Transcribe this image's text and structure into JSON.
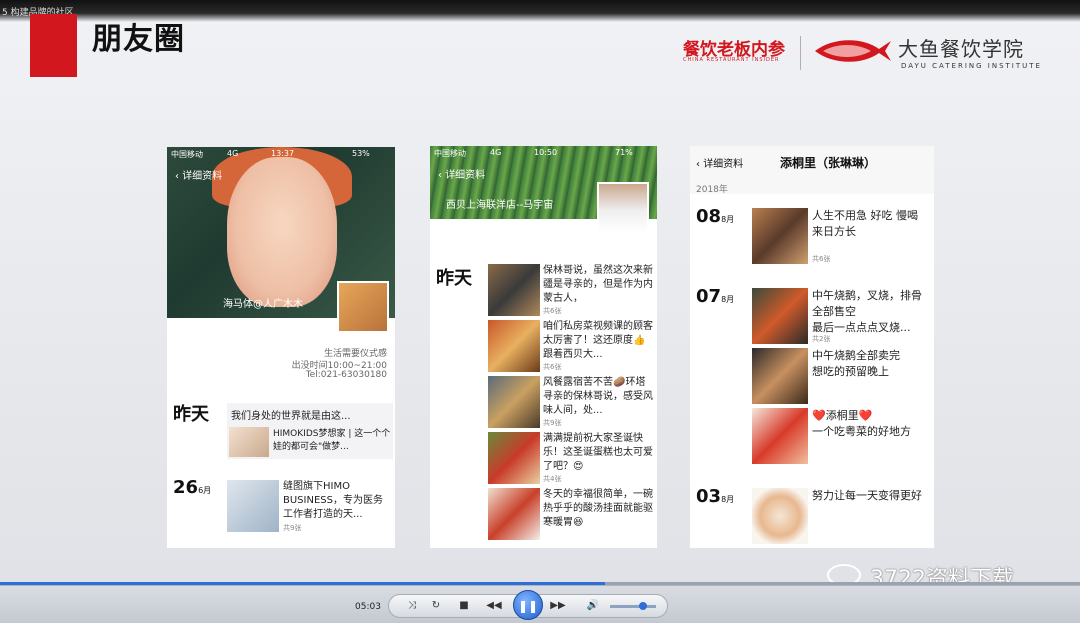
{
  "window": {
    "title_fragment": "5  构建品牌的社区"
  },
  "slide": {
    "title": "朋友圈",
    "brand1": "餐饮老板内参",
    "brand1_sub": "CHINA RESTAURANT INSIDER",
    "brand2": "大鱼餐饮学院",
    "brand2_sub": "DAYU CATERING INSTITUTE",
    "accent": "#d3171e"
  },
  "phone1": {
    "status": {
      "carrier": "中国移动",
      "network": "4G",
      "time": "13:37",
      "battery": "53%"
    },
    "back_label": "详细资料",
    "cover_name": "海马体@人广木木",
    "sign_lines": [
      "生活需要仪式感",
      "出没时间10:00~21:00",
      "Tel:021-63030180"
    ],
    "day1": "昨天",
    "post1_text": "我们身处的世界就是由这...",
    "post2_text": "HIMOKIDS梦想家 | 这一个个娃的都可会\"做梦...",
    "day2": {
      "day": "26",
      "month": "6月"
    },
    "post3_text": "缝图旗下HIMO BUSINESS，专为医务工作者打造的天...",
    "post3_count": "共9张"
  },
  "phone2": {
    "status": {
      "carrier": "中国移动",
      "network": "4G",
      "time": "10:50",
      "battery": "71%"
    },
    "back_label": "详细资料",
    "cover_name": "西贝上海联洋店--马宇宙",
    "day": "昨天",
    "items": [
      {
        "text": "保林哥说，虽然这次来新疆是寻亲的，但是作为内蒙古人，",
        "count": "共6张"
      },
      {
        "text": "咱们私房菜视频课的顾客太厉害了！这还原度👍跟着西贝大...",
        "count": "共6张"
      },
      {
        "text": "风餐露宿苦不苦🥔环塔寻亲的保林哥说，感受风味人间，处...",
        "count": "共9张"
      },
      {
        "text": "满满提前祝大家圣诞快乐！这圣诞蛋糕也太可爱了吧？😍",
        "count": "共4张"
      },
      {
        "text": "冬天的幸福很简单，一碗热乎乎的酸汤挂面就能驱寒暖胃😆",
        "count": ""
      }
    ]
  },
  "phone3": {
    "back_label": "详细资料",
    "title": "添桐里（张琳琳）",
    "year": "2018年",
    "entries": [
      {
        "day": "08",
        "month": "8月",
        "text": "人生不用急 好吃 慢喝 来日方长",
        "count": "共6张"
      },
      {
        "day": "07",
        "month": "8月",
        "text": "中午烧鹅，叉烧，排骨全部售空\n最后一点点点叉烧...",
        "count": "共2张"
      },
      {
        "day": "",
        "month": "",
        "text": "中午烧鹅全部卖完\n想吃的预留晚上",
        "count": ""
      },
      {
        "day": "",
        "month": "",
        "text": "❤️添桐里❤️\n一个吃粤菜的好地方",
        "count": ""
      },
      {
        "day": "03",
        "month": "8月",
        "text": "努力让每一天变得更好",
        "count": ""
      }
    ]
  },
  "player": {
    "time": "05:03",
    "progress": 0.56,
    "volume": 0.72
  },
  "watermark": "3722资料下载"
}
